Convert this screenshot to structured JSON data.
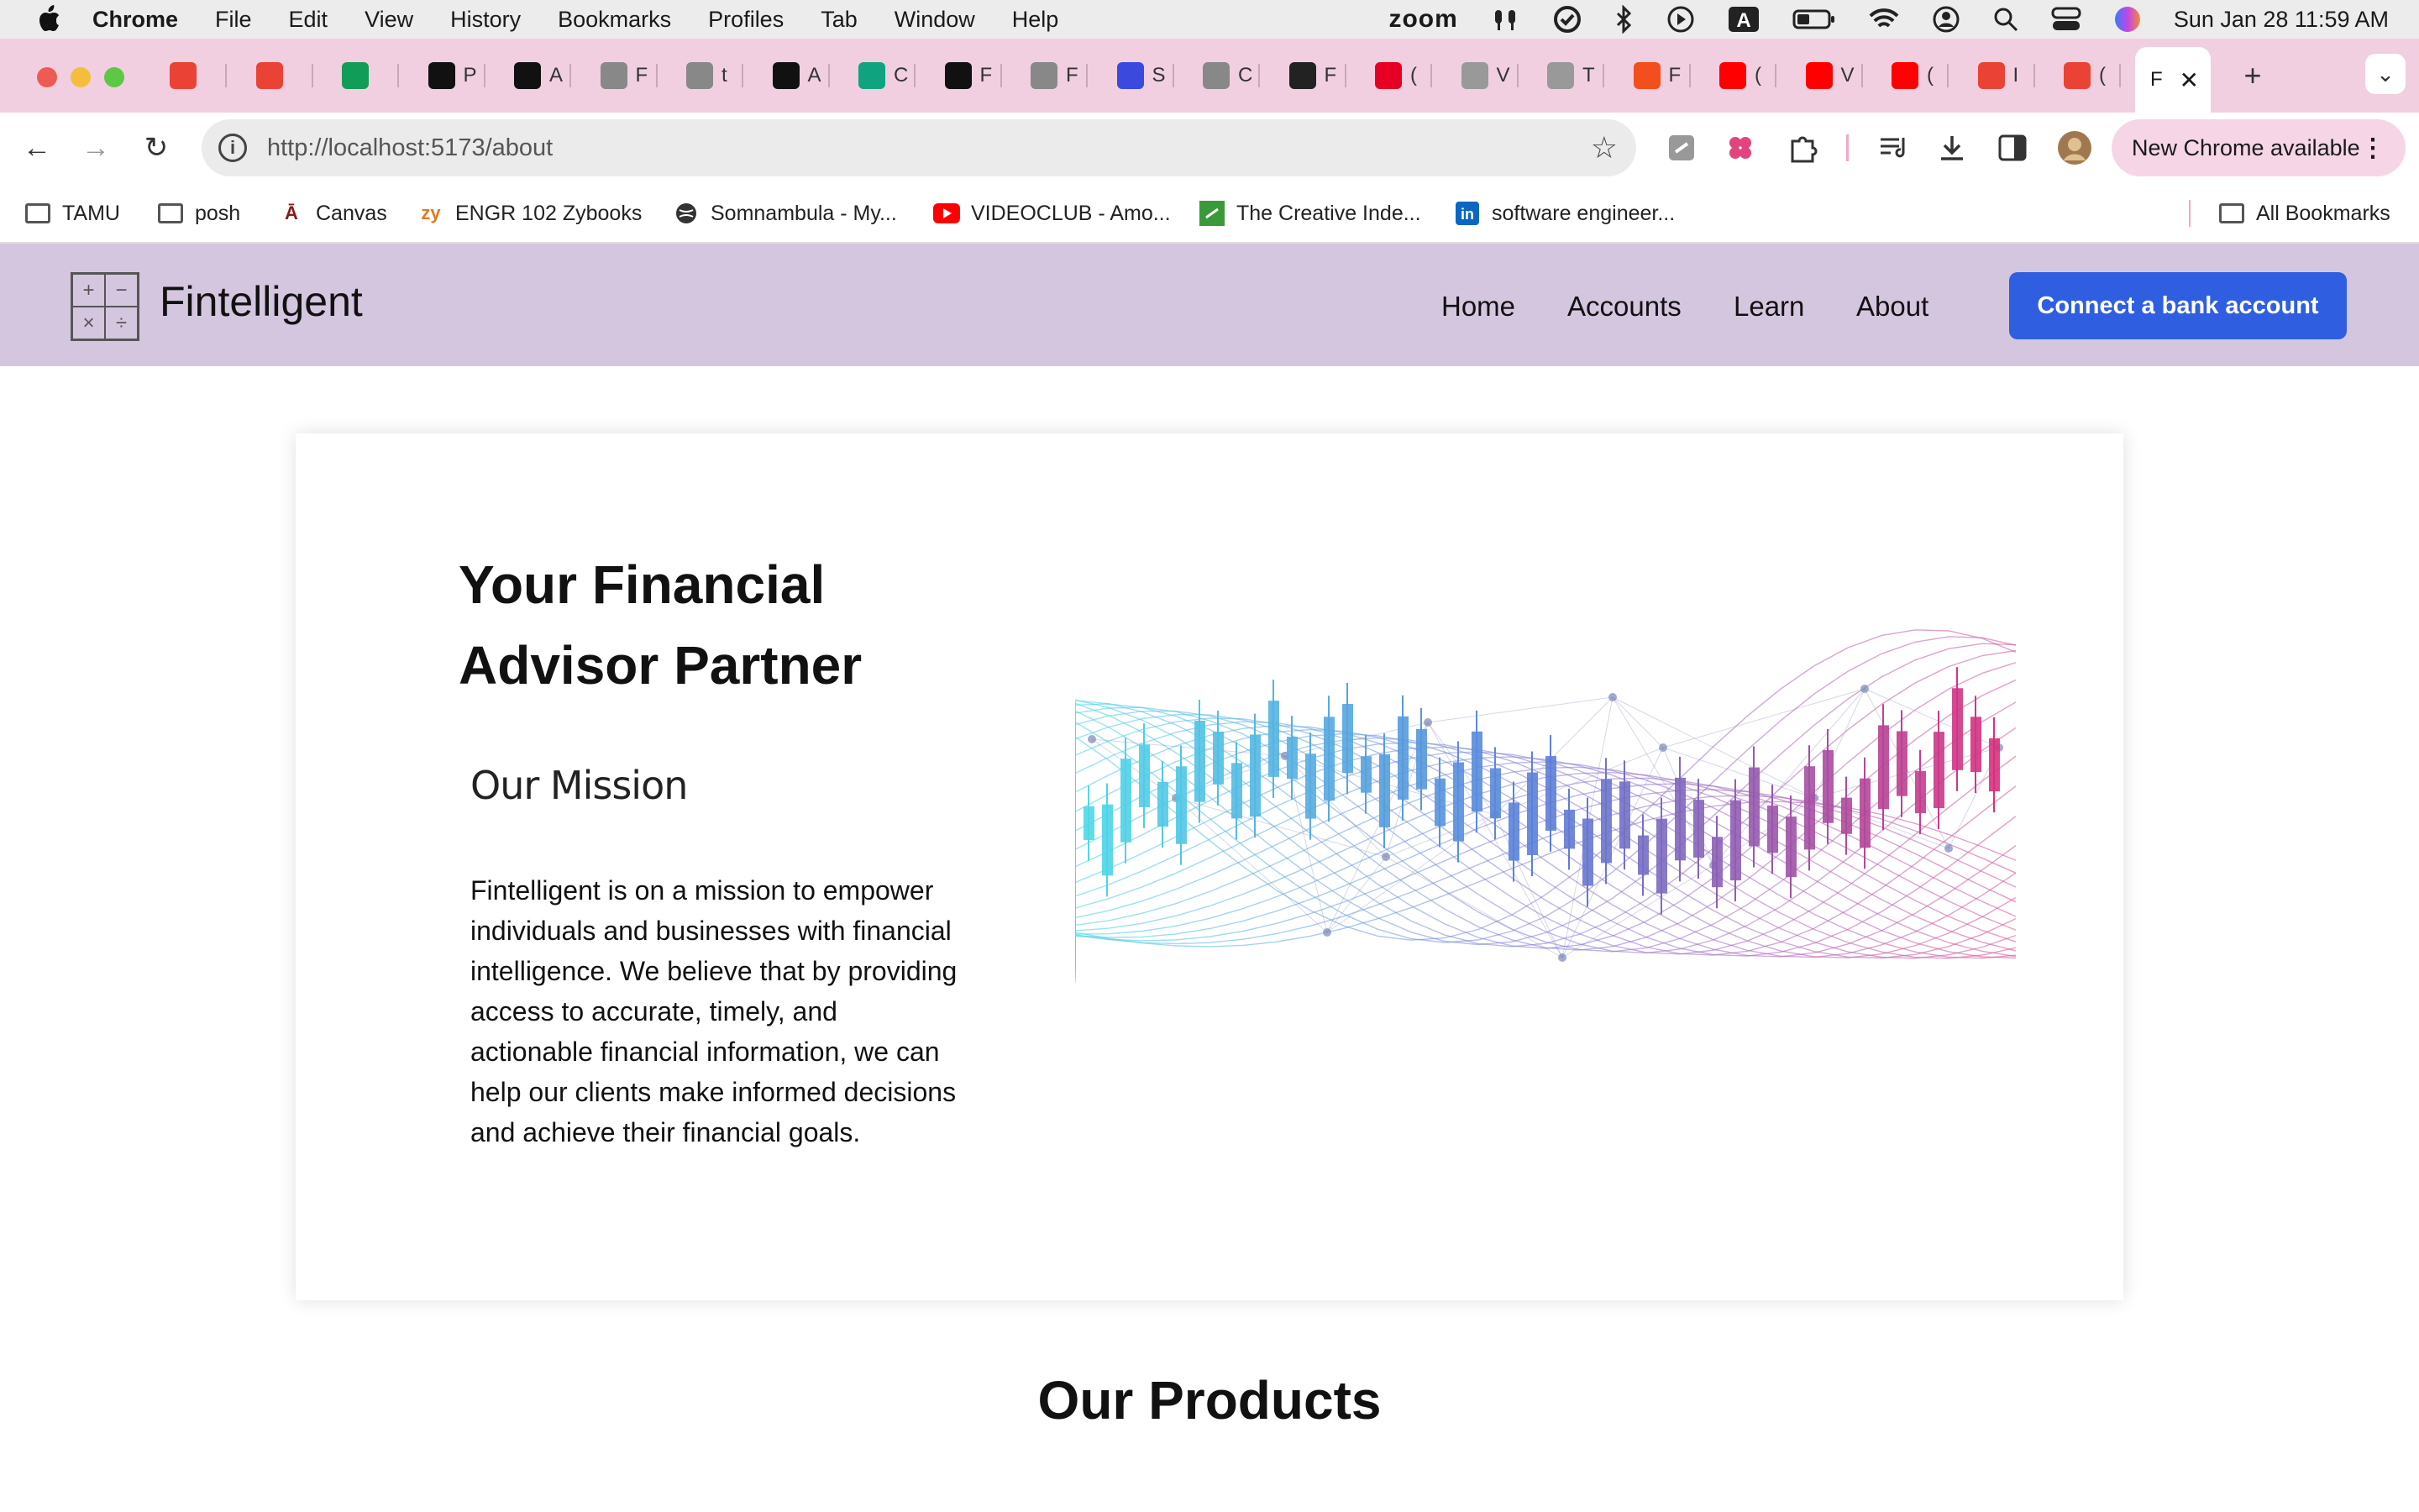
{
  "menubar": {
    "app": "Chrome",
    "items": [
      "File",
      "Edit",
      "View",
      "History",
      "Bookmarks",
      "Profiles",
      "Tab",
      "Window",
      "Help"
    ],
    "zoom_label": "zoom",
    "datetime": "Sun Jan 28  11:59 AM"
  },
  "tabs": [
    {
      "letter": "",
      "color": "#ea4335",
      "icon": "gmail-icon"
    },
    {
      "letter": "",
      "color": "#ea4335",
      "icon": "gmail-icon"
    },
    {
      "letter": "",
      "color": "#0f9d58",
      "icon": "sheets-icon"
    },
    {
      "letter": "P",
      "color": "#111111",
      "icon": "openai-icon"
    },
    {
      "letter": "A",
      "color": "#111111",
      "icon": "openai-icon"
    },
    {
      "letter": "F",
      "color": "#888888",
      "icon": "globe-icon"
    },
    {
      "letter": "t",
      "color": "#888888",
      "icon": "github-icon"
    },
    {
      "letter": "A",
      "color": "#111111",
      "icon": "openai-icon"
    },
    {
      "letter": "C",
      "color": "#10a37f",
      "icon": "chatgpt-icon"
    },
    {
      "letter": "F",
      "color": "#111111",
      "icon": "v-icon"
    },
    {
      "letter": "F",
      "color": "#888888",
      "icon": "hex-icon"
    },
    {
      "letter": "S",
      "color": "#3b49df",
      "icon": "circle-icon"
    },
    {
      "letter": "C",
      "color": "#888888",
      "icon": "circle-icon"
    },
    {
      "letter": "F",
      "color": "#222222",
      "icon": "asterisk-icon"
    },
    {
      "letter": "(",
      "color": "#e60023",
      "icon": "pinterest-icon"
    },
    {
      "letter": "V",
      "color": "#999999",
      "icon": "shield-icon"
    },
    {
      "letter": "T",
      "color": "#999999",
      "icon": "puzzle-icon"
    },
    {
      "letter": "F",
      "color": "#f24e1e",
      "icon": "figma-icon"
    },
    {
      "letter": "(",
      "color": "#ff0000",
      "icon": "youtube-icon"
    },
    {
      "letter": "V",
      "color": "#ff0000",
      "icon": "youtube-icon"
    },
    {
      "letter": "(",
      "color": "#ff0000",
      "icon": "youtube-icon"
    },
    {
      "letter": "I",
      "color": "#ea4335",
      "icon": "gmail-icon"
    },
    {
      "letter": "(",
      "color": "#ea4335",
      "icon": "gmail-icon"
    }
  ],
  "active_tab": {
    "letter": "F"
  },
  "omnibox": {
    "url": "http://localhost:5173/about"
  },
  "new_chrome": "New Chrome available",
  "bookmarks": [
    {
      "label": "TAMU",
      "icon": "folder-icon"
    },
    {
      "label": "posh",
      "icon": "folder-icon"
    },
    {
      "label": "Canvas",
      "icon": "canvas-icon"
    },
    {
      "label": "ENGR 102 Zybooks",
      "icon": "zybooks-icon"
    },
    {
      "label": "Somnambula - My...",
      "icon": "globe-icon"
    },
    {
      "label": "VIDEOCLUB - Amo...",
      "icon": "youtube-icon"
    },
    {
      "label": "The Creative Inde...",
      "icon": "creative-icon"
    },
    {
      "label": "software engineer...",
      "icon": "linkedin-icon"
    }
  ],
  "all_bookmarks": "All Bookmarks",
  "site": {
    "brand": "Fintelligent",
    "nav": [
      "Home",
      "Accounts",
      "Learn",
      "About"
    ],
    "cta": "Connect a bank account",
    "hero_title": "Your Financial Advisor Partner",
    "mission_title": "Our Mission",
    "mission_text": "Fintelligent is on a mission to empower individuals and businesses with financial intelligence. We believe that by providing access to accurate, timely, and actionable financial information, we can help our clients make informed decisions and achieve their financial goals.",
    "products_title": "Our Products"
  },
  "colors": {
    "nav_bg": "#d5c6e0",
    "cta_bg": "#2f5fe0",
    "tabstrip_bg": "#f1cfe0",
    "illustration_start": "#4fd8e8",
    "illustration_mid": "#5b7fd8",
    "illustration_end": "#d8307f"
  }
}
